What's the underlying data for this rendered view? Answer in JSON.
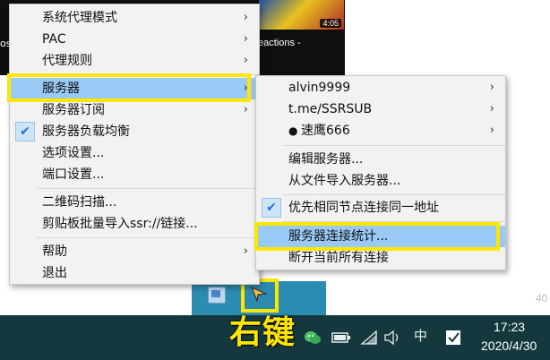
{
  "background": {
    "video_duration": "4:05",
    "video_title_fragment": "eactions -",
    "left_fragment": "os",
    "side_number": "40"
  },
  "main_menu": {
    "items": [
      {
        "label": "系统代理模式",
        "submenu": true
      },
      {
        "label": "PAC",
        "submenu": true
      },
      {
        "label": "代理规则",
        "submenu": true
      },
      {
        "label": "服务器",
        "submenu": true,
        "highlighted": true
      },
      {
        "label": "服务器订阅",
        "submenu": true
      },
      {
        "label": "服务器负载均衡",
        "checked": true
      },
      {
        "label": "选项设置..."
      },
      {
        "label": "端口设置..."
      },
      {
        "label": "二维码扫描..."
      },
      {
        "label": "剪贴板批量导入ssr://链接..."
      },
      {
        "label": "帮助",
        "submenu": true
      },
      {
        "label": "退出"
      }
    ],
    "arrow_glyph": "›"
  },
  "server_submenu": {
    "items": [
      {
        "label": "alvin9999",
        "submenu": true
      },
      {
        "label": "t.me/SSRSUB",
        "submenu": true
      },
      {
        "label": "速鹰666",
        "submenu": true,
        "bullet": "●"
      },
      {
        "label": "编辑服务器..."
      },
      {
        "label": "从文件导入服务器..."
      },
      {
        "label": "优先相同节点连接同一地址",
        "checked": true
      },
      {
        "label": "服务器连接统计...",
        "highlighted": true
      },
      {
        "label": "断开当前所有连接"
      }
    ]
  },
  "check_glyph": "✔",
  "annotation_label": "右键",
  "taskbar": {
    "ime_label": "中",
    "time": "17:23",
    "date": "2020/4/30"
  },
  "colors": {
    "highlight_yellow": "#ffe600",
    "menu_hover": "#99c9f5",
    "taskbar": "#14383d",
    "flyout": "#2c8bb0"
  },
  "icons": {
    "tray_flyout_app": "ssr-app-icon",
    "cursor": "paper-plane-icon",
    "wechat": "wechat-icon",
    "battery": "battery-icon",
    "wifi": "wifi-icon",
    "volume": "volume-icon",
    "action_center": "notification-icon"
  }
}
